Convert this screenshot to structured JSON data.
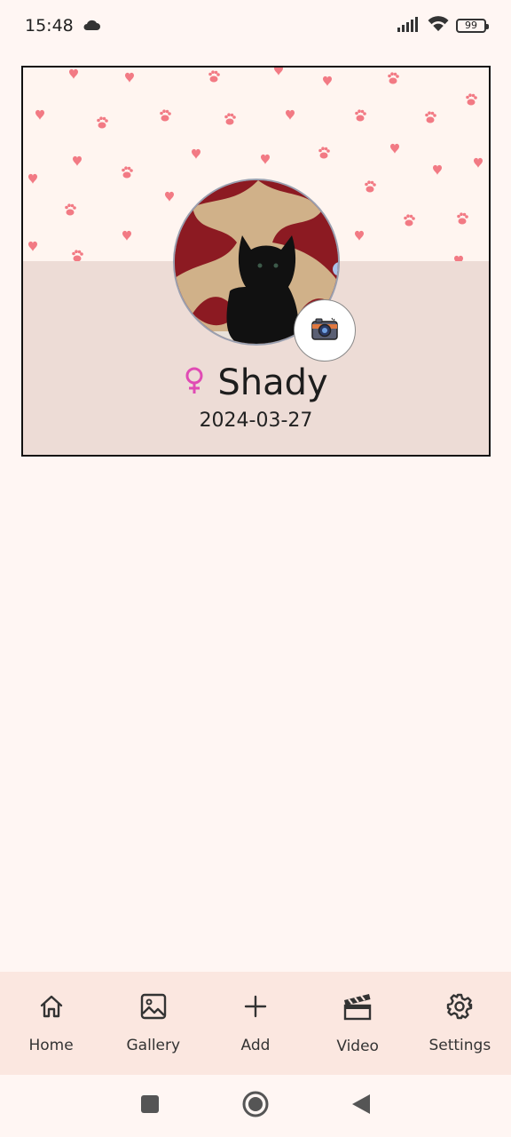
{
  "status_bar": {
    "time": "15:48",
    "battery": "99",
    "icons": [
      "cloud-icon",
      "signal-icon",
      "wifi-icon",
      "battery-icon"
    ]
  },
  "profile": {
    "name": "Shady",
    "birthdate": "2024-03-27",
    "gender_icon": "female-icon",
    "camera_icon": "camera-icon"
  },
  "bottom_nav": {
    "items": [
      {
        "label": "Home",
        "icon": "home-icon"
      },
      {
        "label": "Gallery",
        "icon": "image-icon"
      },
      {
        "label": "Add",
        "icon": "plus-icon"
      },
      {
        "label": "Video",
        "icon": "clapperboard-icon"
      },
      {
        "label": "Settings",
        "icon": "gear-icon"
      }
    ]
  },
  "colors": {
    "background": "#fff6f3",
    "card_bottom": "#eddcd6",
    "pattern_accent": "#f27a84",
    "gender_accent": "#e04bb4",
    "nav_background": "#fbe7e0"
  }
}
